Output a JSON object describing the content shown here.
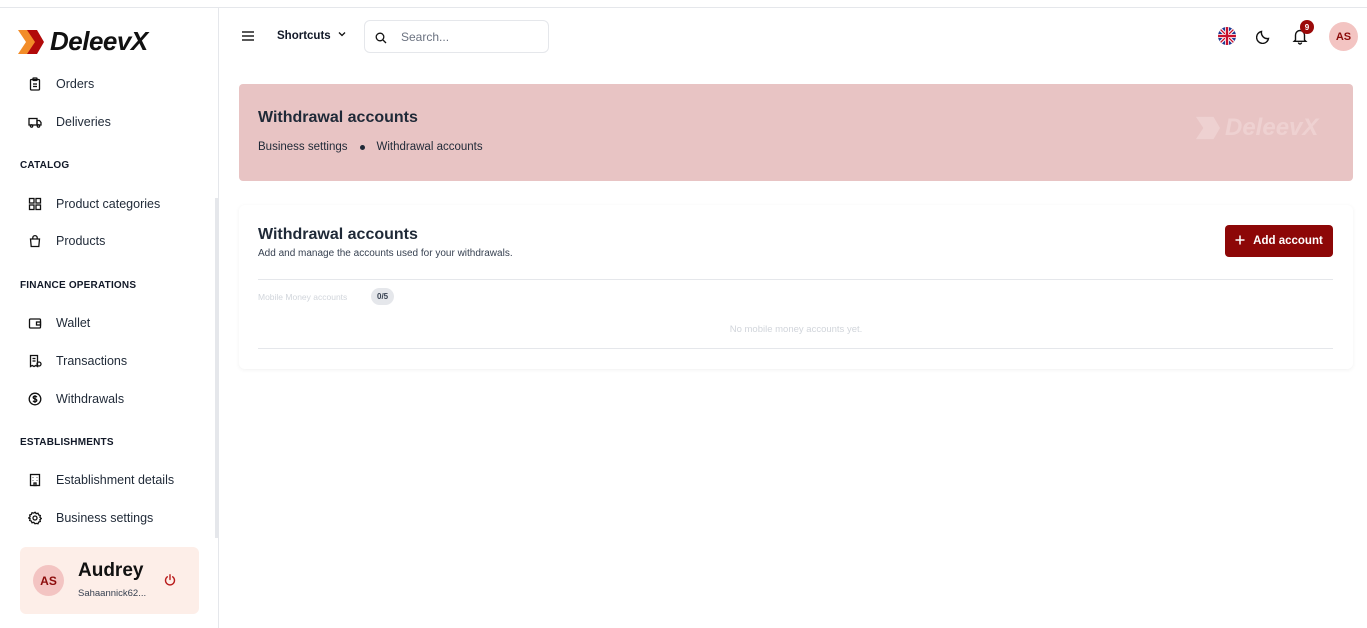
{
  "brand": {
    "name": "DeleevX",
    "watermark": "DeleevX"
  },
  "sidebar": {
    "items": [
      {
        "label": "Orders",
        "icon": "clipboard-icon"
      },
      {
        "label": "Deliveries",
        "icon": "truck-icon"
      },
      {
        "label": "Product categories",
        "icon": "grid-icon"
      },
      {
        "label": "Products",
        "icon": "shopping-bag-icon"
      },
      {
        "label": "Wallet",
        "icon": "wallet-icon"
      },
      {
        "label": "Transactions",
        "icon": "receipt-icon"
      },
      {
        "label": "Withdrawals",
        "icon": "dollar-circle-icon"
      },
      {
        "label": "Establishment details",
        "icon": "building-icon"
      },
      {
        "label": "Business settings",
        "icon": "gear-icon"
      }
    ],
    "sections": {
      "catalog": "CATALOG",
      "finance": "FINANCE OPERATIONS",
      "establishments": "ESTABLISHMENTS"
    },
    "user": {
      "initials": "AS",
      "name": "Audrey",
      "email": "Sahaannick62..."
    }
  },
  "header": {
    "shortcuts_label": "Shortcuts",
    "search_placeholder": "Search...",
    "notification_count": "9",
    "avatar_initials": "AS"
  },
  "banner": {
    "title": "Withdrawal accounts",
    "breadcrumb": [
      "Business settings",
      "Withdrawal accounts"
    ]
  },
  "card": {
    "title": "Withdrawal accounts",
    "subtitle": "Add and manage the accounts used for your withdrawals.",
    "add_button_label": "Add account",
    "mobile_money_label": "Mobile Money accounts",
    "mobile_money_count": "0/5",
    "empty_message": "No mobile money accounts yet."
  },
  "colors": {
    "accent": "#8d0707",
    "banner_bg": "#e8c4c4",
    "user_card_bg": "#fdeee8"
  }
}
